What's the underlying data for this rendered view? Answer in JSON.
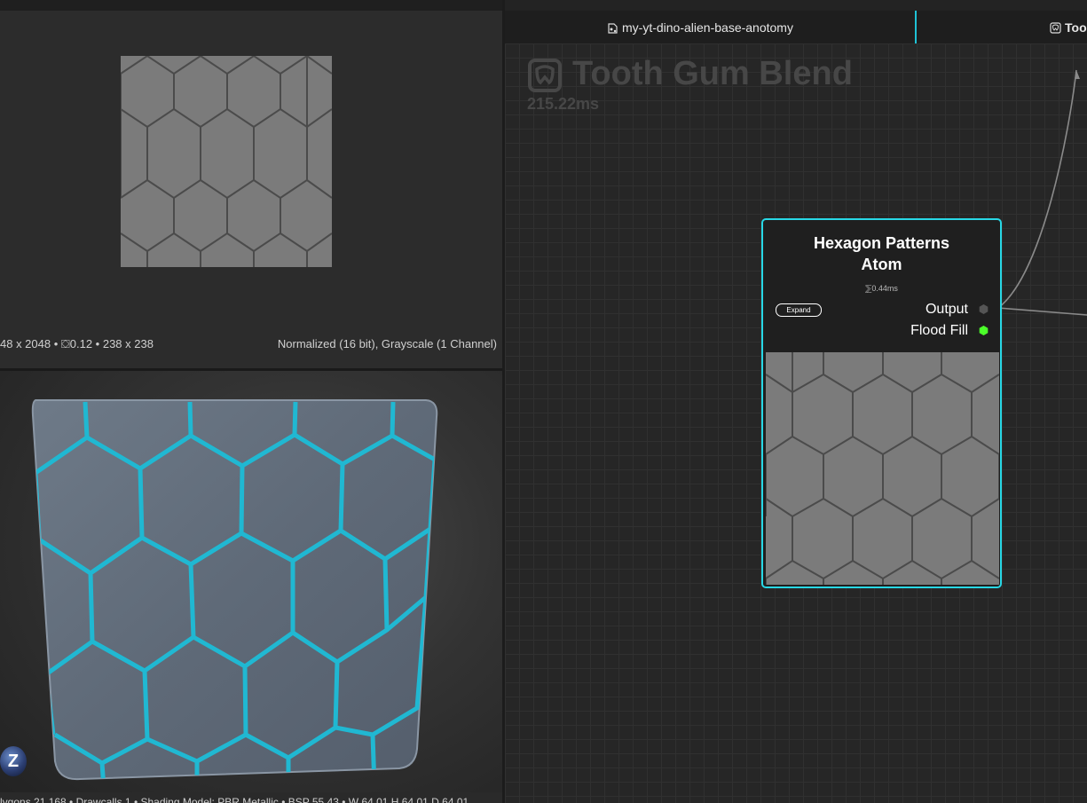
{
  "preview_2d": {
    "info_left": "48 x 2048 • ⛋0.12 • 238 x 238",
    "info_right": "Normalized (16 bit), Grayscale (1 Channel)"
  },
  "preview_3d": {
    "stats": "lygons 21,168 • Drawcalls 1 • Shading Model: PBR Metallic • BSP 55.43 • W 64.01 H 64.01 D 64.01",
    "badge": "Z"
  },
  "tabs": {
    "graph": "my-yt-dino-alien-base-anotomy",
    "tooth": "Too"
  },
  "graph": {
    "title": "Tooth Gum Blend",
    "time": "215.22ms"
  },
  "node": {
    "title_line1": "Hexagon Patterns",
    "title_line2": "Atom",
    "time": "⅀0.44ms",
    "expand_label": "Expand",
    "port_output": "Output",
    "port_flood": "Flood Fill"
  },
  "colors": {
    "accent": "#28d8e6",
    "port_active": "#4cff2a",
    "port_inactive": "#555555"
  }
}
